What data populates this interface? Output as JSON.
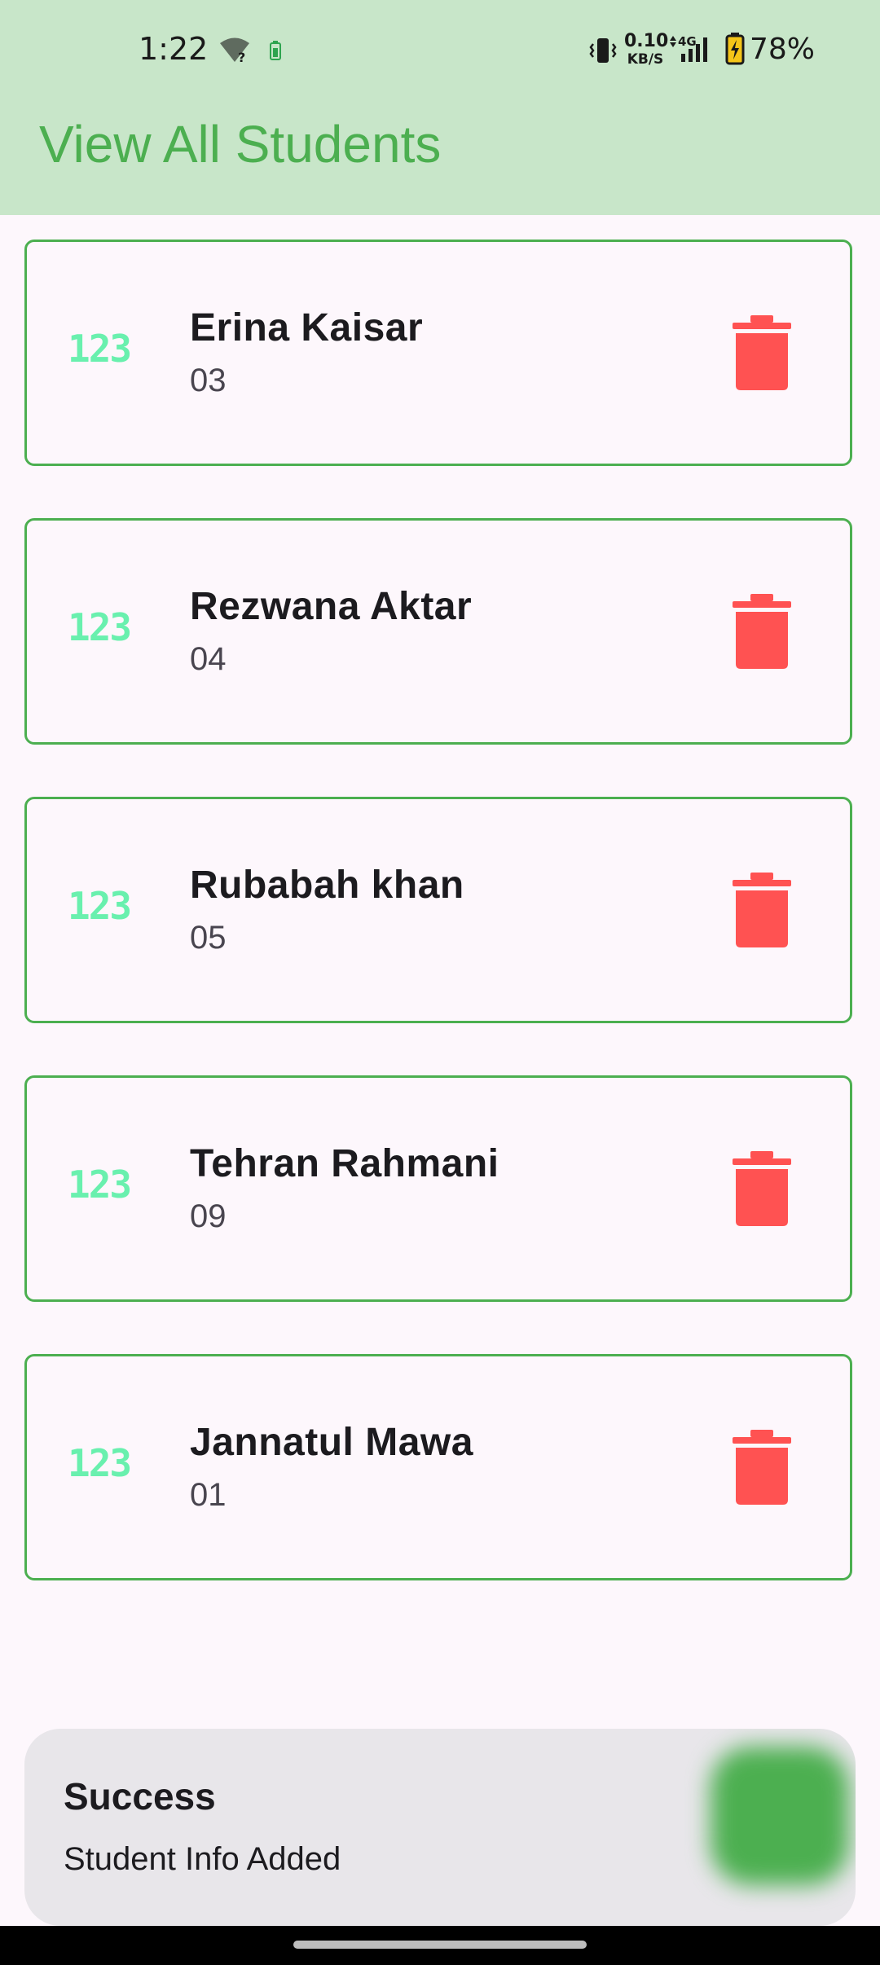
{
  "status_bar": {
    "time": "1:22",
    "speed_value": "0.10",
    "speed_unit": "KB/S",
    "network": "4G",
    "battery_percent": "78%"
  },
  "app_bar": {
    "title": "View All Students"
  },
  "students": [
    {
      "name": "Erina Kaisar",
      "roll": "03",
      "icon_text": "123"
    },
    {
      "name": "Rezwana Aktar",
      "roll": "04",
      "icon_text": "123"
    },
    {
      "name": "Rubabah khan",
      "roll": "05",
      "icon_text": "123"
    },
    {
      "name": "Tehran Rahmani",
      "roll": "09",
      "icon_text": "123"
    },
    {
      "name": "Jannatul Mawa",
      "roll": "01",
      "icon_text": "123"
    }
  ],
  "snackbar": {
    "title": "Success",
    "message": "Student Info Added"
  },
  "colors": {
    "primary": "#4caf50",
    "app_bar_bg": "#c8e6c9",
    "delete": "#ff5252",
    "number_icon": "#69f0ae"
  },
  "icons": {
    "leading": "numbers-icon",
    "trailing": "delete-icon"
  }
}
